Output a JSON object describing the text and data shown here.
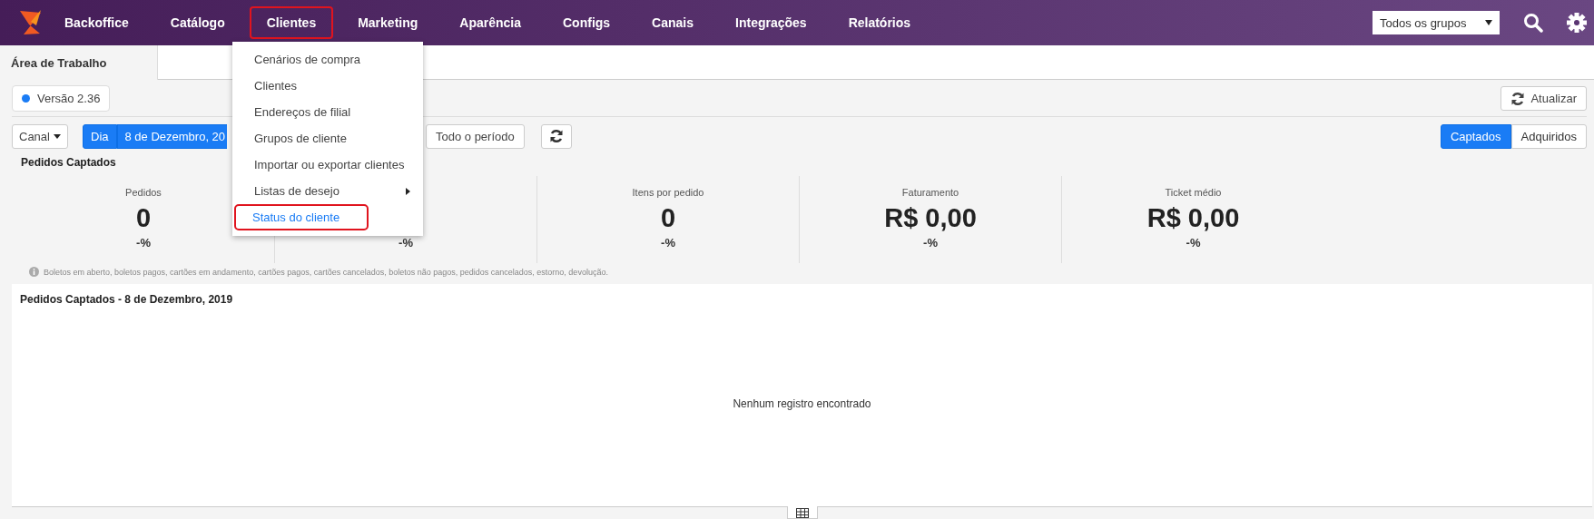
{
  "navbar": {
    "items": [
      {
        "label": "Backoffice",
        "selected": false
      },
      {
        "label": "Catálogo",
        "selected": false
      },
      {
        "label": "Clientes",
        "selected": true
      },
      {
        "label": "Marketing",
        "selected": false
      },
      {
        "label": "Aparência",
        "selected": false
      },
      {
        "label": "Configs",
        "selected": false
      },
      {
        "label": "Canais",
        "selected": false
      },
      {
        "label": "Integrações",
        "selected": false
      },
      {
        "label": "Relatórios",
        "selected": false
      }
    ],
    "group_select": {
      "value": "Todos os grupos"
    }
  },
  "dropdown": {
    "items": [
      {
        "label": "Cenários de compra",
        "has_submenu": false,
        "selected": false
      },
      {
        "label": "Clientes",
        "has_submenu": false,
        "selected": false
      },
      {
        "label": "Endereços de filial",
        "has_submenu": false,
        "selected": false
      },
      {
        "label": "Grupos de cliente",
        "has_submenu": false,
        "selected": false
      },
      {
        "label": "Importar ou exportar clientes",
        "has_submenu": false,
        "selected": false
      },
      {
        "label": "Listas de desejo",
        "has_submenu": true,
        "selected": false
      },
      {
        "label": "Status do cliente",
        "has_submenu": false,
        "selected": true
      }
    ]
  },
  "tabs": [
    {
      "label": "Área de Trabalho",
      "selected": true
    }
  ],
  "version": {
    "label": "Versão 2.36",
    "color": "#1a7cf5"
  },
  "refresh_button": {
    "label": "Atualizar"
  },
  "toolbar": {
    "channel": "Canal",
    "period_buttons": [
      {
        "label": "Dia",
        "selected": true
      },
      {
        "label": "8 de Dezembro, 20",
        "selected": true
      }
    ],
    "all_period": "Todo o período",
    "modes": [
      {
        "label": "Captados",
        "selected": true
      },
      {
        "label": "Adquiridos",
        "selected": false
      }
    ]
  },
  "summary": {
    "title": "Pedidos Captados",
    "stats": [
      {
        "label": "Pedidos",
        "value": "0",
        "change": "-%"
      },
      {
        "change": "-%"
      },
      {
        "label": "Itens por pedido",
        "value": "0",
        "change": "-%"
      },
      {
        "label": "Faturamento",
        "value": "R$ 0,00",
        "change": "-%"
      },
      {
        "label": "Ticket médio",
        "value": "R$ 0,00",
        "change": "-%"
      }
    ],
    "note": "Boletos em aberto, boletos pagos, cartões em andamento, cartões pagos, cartões cancelados, boletos não pagos, pedidos cancelados, estorno, devolução."
  },
  "chart_panel": {
    "title": "Pedidos Captados - 8 de Dezembro, 2019",
    "empty_message": "Nenhum registro encontrado"
  }
}
